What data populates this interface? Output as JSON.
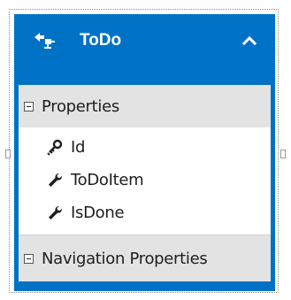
{
  "entity": {
    "title": "ToDo",
    "icon": "entity-icon",
    "collapse_icon": "chevron-up-icon",
    "accent_color": "#0072c6"
  },
  "sections": {
    "properties": {
      "label": "Properties",
      "toggle_icon": "collapse-minus-icon",
      "items": [
        {
          "label": "Id",
          "icon": "key-icon"
        },
        {
          "label": "ToDoItem",
          "icon": "wrench-icon"
        },
        {
          "label": "IsDone",
          "icon": "wrench-icon"
        }
      ]
    },
    "navigation": {
      "label": "Navigation Properties",
      "toggle_icon": "collapse-minus-icon"
    }
  }
}
